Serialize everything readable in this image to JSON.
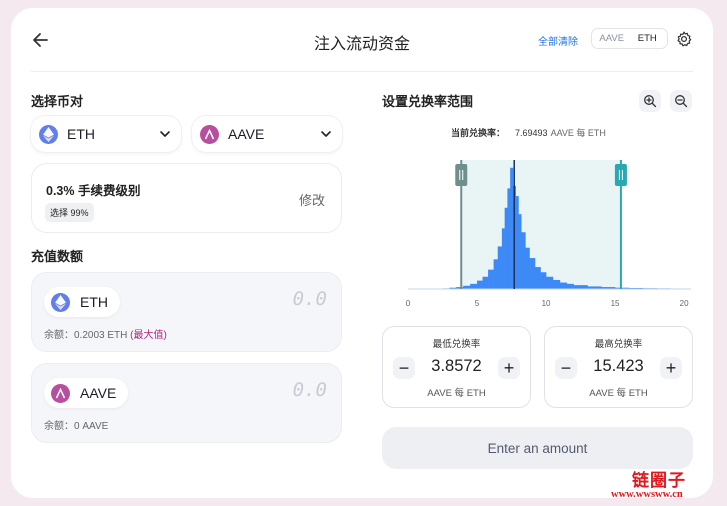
{
  "header": {
    "title": "注入流动资金",
    "clear_all": "全部清除",
    "toggle_tokens": [
      "AAVE",
      "ETH"
    ]
  },
  "pair": {
    "label": "选择币对",
    "token_a": "ETH",
    "token_b": "AAVE"
  },
  "fee": {
    "tier": "0.3% 手续费级别",
    "selected": "选择 99%",
    "edit": "修改"
  },
  "deposit": {
    "label": "充值数额",
    "token_a": {
      "symbol": "ETH",
      "amount": "0.0",
      "balance_label": "余额：",
      "balance": "0.2003 ETH",
      "max": "(最大值)"
    },
    "token_b": {
      "symbol": "AAVE",
      "amount": "0.0",
      "balance_label": "余额：",
      "balance": "0 AAVE"
    }
  },
  "range": {
    "label": "设置兑换率范围",
    "current_label": "当前兑换率：",
    "current_value": "7.69493",
    "current_unit": "AAVE 每 ETH",
    "min": {
      "title": "最低兑换率",
      "value": "3.8572",
      "unit": "AAVE 每 ETH"
    },
    "max": {
      "title": "最高兑换率",
      "value": "15.423",
      "unit": "AAVE 每 ETH"
    }
  },
  "chart_data": {
    "type": "area",
    "x_ticks": [
      "0",
      "5",
      "10",
      "15",
      "20"
    ],
    "xlim": [
      0,
      20.5
    ],
    "current_price": 7.69493,
    "range_min": 3.8572,
    "range_max": 15.423,
    "x": [
      2.5,
      3.0,
      3.5,
      4.0,
      4.5,
      5.0,
      5.4,
      5.8,
      6.2,
      6.5,
      6.8,
      7.0,
      7.2,
      7.4,
      7.6,
      7.8,
      8.0,
      8.2,
      8.5,
      8.8,
      9.2,
      9.6,
      10.0,
      10.5,
      11.0,
      11.5,
      12.0,
      13.0,
      14.0,
      15.0,
      16.0,
      17.0,
      18.0,
      19.0,
      20.0
    ],
    "values": [
      0.5,
      1.0,
      1.5,
      2.5,
      4.0,
      6.5,
      9.5,
      15,
      23,
      33,
      47,
      63,
      78,
      94,
      80,
      72,
      58,
      44,
      32,
      24,
      17,
      13,
      9.5,
      7.0,
      5.0,
      4.0,
      3.0,
      2.0,
      1.5,
      1.0,
      0.8,
      0.6,
      0.5,
      0.4,
      0.3
    ],
    "ylim": [
      0,
      100
    ],
    "colors": {
      "area": "#3d8af7",
      "range_fill": "#e9f5f5",
      "current_line": "#1c2f5b",
      "min_handle": "#6f8e8e",
      "max_handle": "#25a9b4"
    }
  },
  "action": {
    "enter_amount": "Enter an amount"
  },
  "watermark": {
    "title": "链圈子",
    "url": "www.wwsww.cn"
  }
}
